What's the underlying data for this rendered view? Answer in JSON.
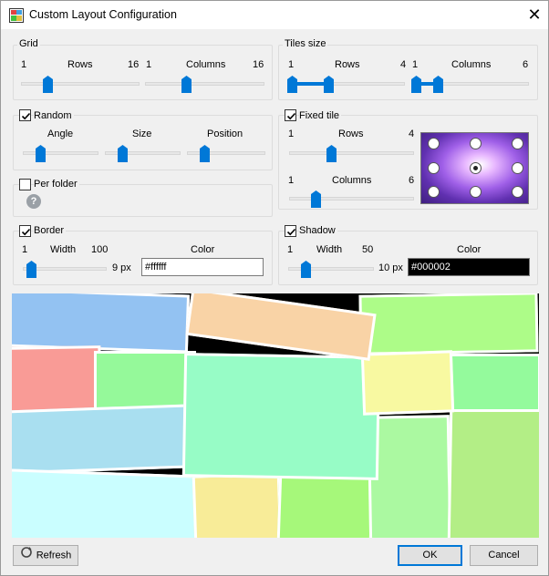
{
  "window": {
    "title": "Custom Layout Configuration",
    "close_glyph": "✕"
  },
  "grid": {
    "title": "Grid",
    "rows": {
      "min": "1",
      "label": "Rows",
      "max": "16",
      "value": 4
    },
    "columns": {
      "min": "1",
      "label": "Columns",
      "max": "16",
      "value": 4
    }
  },
  "tiles_size": {
    "title": "Tiles size",
    "rows": {
      "min": "1",
      "label": "Rows",
      "max": "4",
      "low": 1,
      "high": 2
    },
    "columns": {
      "min": "1",
      "label": "Columns",
      "max": "6",
      "low": 1,
      "high": 2
    }
  },
  "random": {
    "label": "Random",
    "checked": true,
    "angle": "Angle",
    "size": "Size",
    "position": "Position"
  },
  "fixed_tile": {
    "label": "Fixed tile",
    "checked": true,
    "rows": {
      "min": "1",
      "label": "Rows",
      "max": "4",
      "value": 2
    },
    "columns": {
      "min": "1",
      "label": "Columns",
      "max": "6",
      "value": 2
    }
  },
  "per_folder": {
    "label": "Per folder",
    "checked": false,
    "help_icon": "question-mark-icon"
  },
  "border": {
    "label": "Border",
    "checked": true,
    "width_min": "1",
    "width_label": "Width",
    "width_max": "100",
    "width_value": "9 px",
    "color_label": "Color",
    "color_value": "#ffffff"
  },
  "shadow": {
    "label": "Shadow",
    "checked": true,
    "width_min": "1",
    "width_label": "Width",
    "width_max": "50",
    "width_value": "10 px",
    "color_label": "Color",
    "color_value": "#000002"
  },
  "buttons": {
    "refresh": "Refresh",
    "ok": "OK",
    "cancel": "Cancel"
  },
  "colors": {
    "accent": "#0078d7"
  },
  "preview_tiles": [
    {
      "color": "#93c2f2"
    },
    {
      "color": "#f9d3a6"
    },
    {
      "color": "#adfc88"
    },
    {
      "color": "#f99b96"
    },
    {
      "color": "#95f99a"
    },
    {
      "color": "#97fcc6"
    },
    {
      "color": "#f8f9a1"
    },
    {
      "color": "#94fa9c"
    },
    {
      "color": "#a9dff0"
    },
    {
      "color": "#abf9a1"
    },
    {
      "color": "#b3ee86"
    },
    {
      "color": "#cafeff"
    },
    {
      "color": "#f8ec98"
    },
    {
      "color": "#a6f87a"
    }
  ]
}
